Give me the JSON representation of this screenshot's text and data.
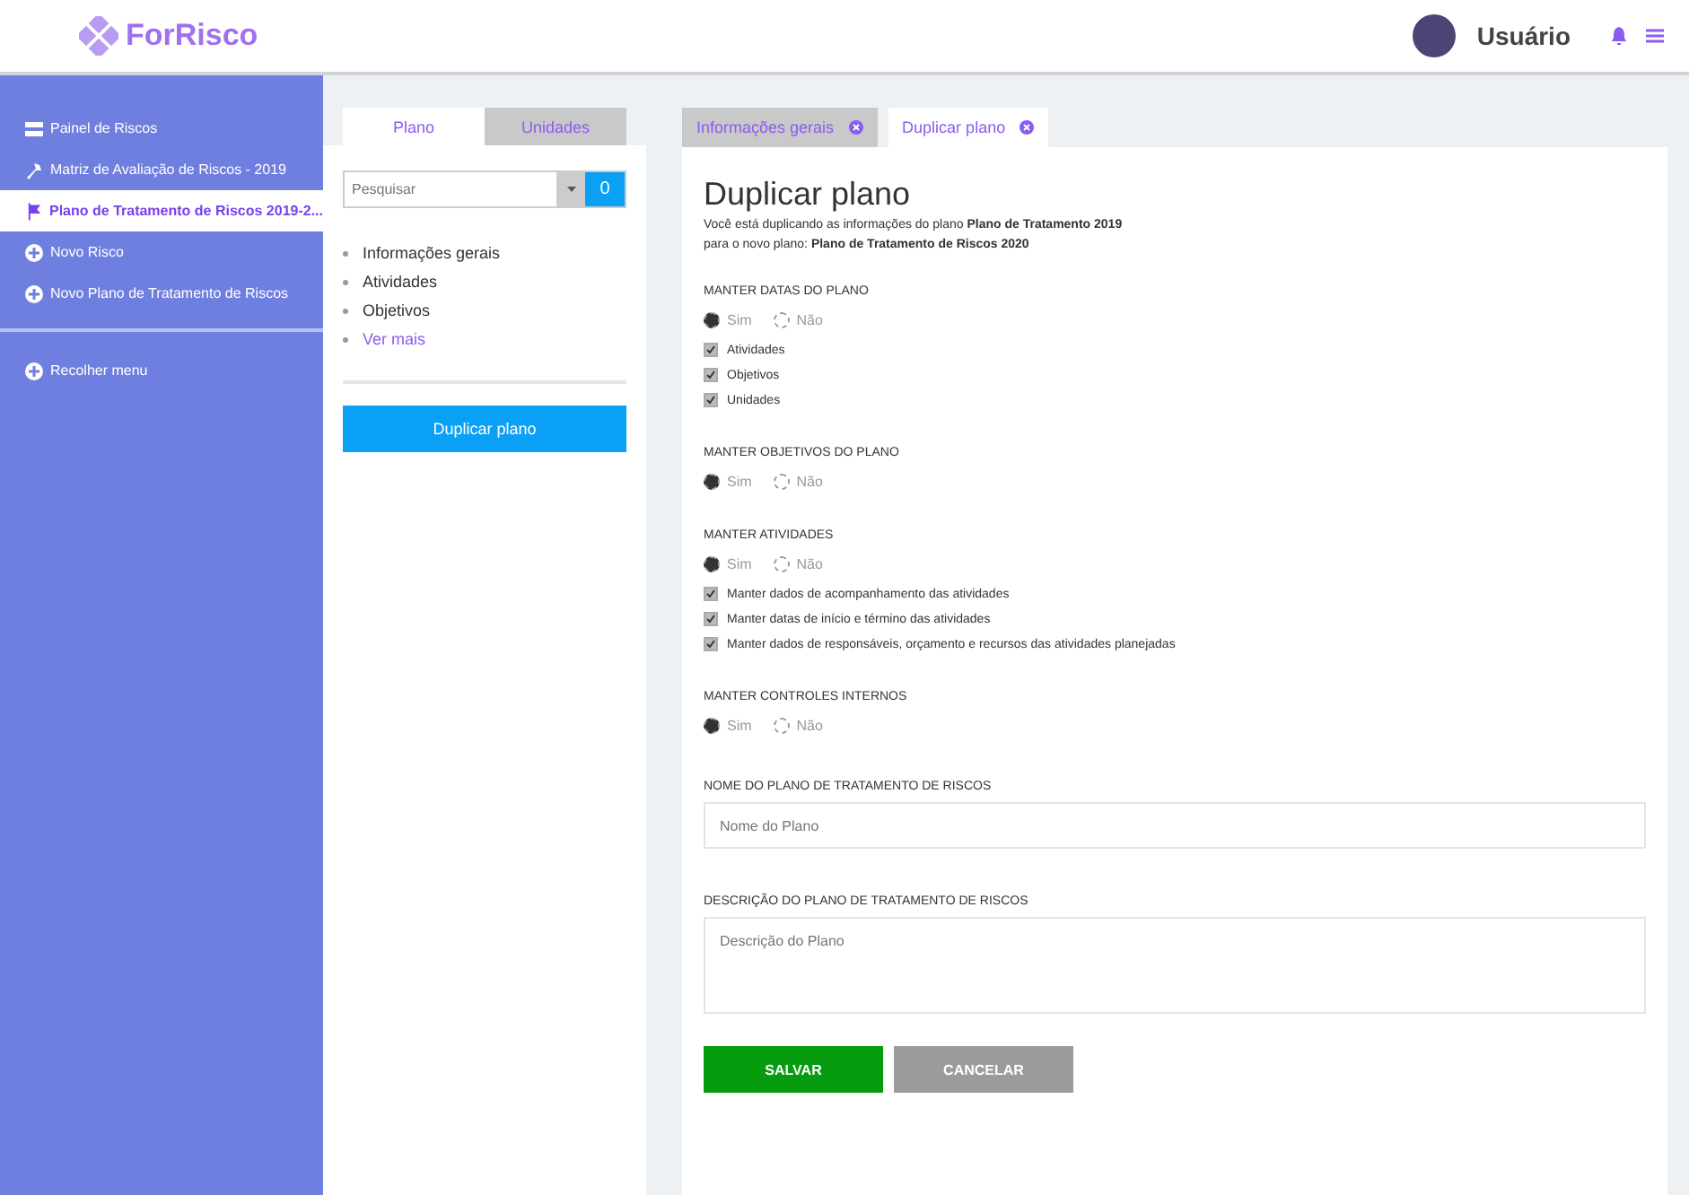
{
  "header": {
    "logo": "ForRisco",
    "user": "Usuário"
  },
  "sidebar": {
    "items": [
      {
        "label": "Painel de Riscos",
        "selected": false
      },
      {
        "label": "Matriz de Avaliação de Riscos - 2019",
        "selected": false
      },
      {
        "label": "Plano de Tratamento de Riscos 2019-2...",
        "selected": true
      },
      {
        "label": "Novo Risco",
        "selected": false
      },
      {
        "label": "Novo Plano de Tratamento de Riscos",
        "selected": false
      }
    ],
    "footer": "Recolher menu"
  },
  "middle": {
    "tabs": [
      {
        "label": "Plano",
        "selected": true
      },
      {
        "label": "Unidades",
        "selected": false
      }
    ],
    "search": {
      "placeholder": "Pesquisar",
      "button": "0"
    },
    "outline": [
      {
        "label": "Informações gerais",
        "kind": "normal"
      },
      {
        "label": "Atividades",
        "kind": "normal"
      },
      {
        "label": "Objetivos",
        "kind": "normal"
      },
      {
        "label": "Ver mais",
        "kind": "link"
      }
    ],
    "action": "Duplicar plano"
  },
  "content": {
    "tabs": [
      {
        "label": "Informações gerais",
        "selected": false
      },
      {
        "label": "Duplicar plano",
        "selected": true
      }
    ],
    "title": "Duplicar plano",
    "description": [
      "Você está duplicando as informações do plano **Plano de Tratamento 2019**",
      "para o novo plano: **Plano de Tratamento de Riscos 2020**"
    ],
    "sections": [
      {
        "label": "MANTER DATAS DO PLANO",
        "options": [
          {
            "label": "Sim",
            "selected": true
          },
          {
            "label": "Não",
            "selected": false
          }
        ],
        "checks": [
          {
            "label": "Atividades",
            "checked": true
          },
          {
            "label": "Objetivos",
            "checked": true
          },
          {
            "label": "Unidades",
            "checked": true
          }
        ]
      },
      {
        "label": "MANTER OBJETIVOS DO PLANO",
        "options": [
          {
            "label": "Sim",
            "selected": true
          },
          {
            "label": "Não",
            "selected": false
          }
        ]
      },
      {
        "label": "MANTER ATIVIDADES",
        "options": [
          {
            "label": "Sim",
            "selected": true
          },
          {
            "label": "Não",
            "selected": false
          }
        ],
        "checks": [
          {
            "label": "Manter dados de acompanhamento das atividades",
            "checked": true
          },
          {
            "label": "Manter datas de início e término das atividades",
            "checked": true
          },
          {
            "label": "Manter dados de responsáveis, orçamento e recursos das atividades planejadas",
            "checked": true
          }
        ]
      },
      {
        "label": "MANTER CONTROLES INTERNOS",
        "options": [
          {
            "label": "Sim",
            "selected": true
          },
          {
            "label": "Não",
            "selected": false
          }
        ]
      }
    ],
    "name_field": {
      "label": "NOME DO PLANO DE TRATAMENTO DE RISCOS",
      "placeholder": "Nome do Plano"
    },
    "description_field": {
      "label": "DESCRIÇÃO DO PLANO DE TRATAMENTO DE RISCOS",
      "placeholder": "Descrição do Plano"
    },
    "buttons": [
      {
        "label": "SALVAR",
        "kind": "primary"
      },
      {
        "label": "CANCELAR",
        "kind": "secondary"
      }
    ]
  }
}
